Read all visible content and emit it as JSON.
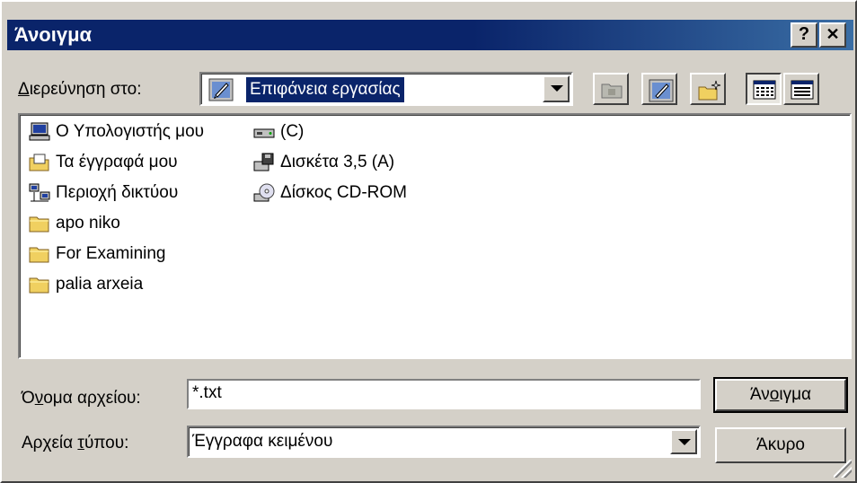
{
  "dialog": {
    "title": "Άνοιγμα",
    "help_btn": "?",
    "close_btn": "✕"
  },
  "lookin": {
    "label_pre": "Δ",
    "label_rest": "ιερεύνηση στο:",
    "value": "Επιφάνεια εργασίας",
    "icon": "desktop-icon"
  },
  "toolbar": {
    "buttons": [
      {
        "name": "up-one-level",
        "icon": "up-folder-icon"
      },
      {
        "name": "desktop",
        "icon": "desktop-icon"
      },
      {
        "name": "new-folder",
        "icon": "new-folder-icon"
      },
      {
        "name": "list-view",
        "icon": "list-view-icon",
        "pressed": true
      },
      {
        "name": "details-view",
        "icon": "details-view-icon"
      }
    ]
  },
  "files": {
    "col1": [
      {
        "label": "Ο Υπολογιστής μου",
        "icon": "my-computer-icon"
      },
      {
        "label": "Τα έγγραφά μου",
        "icon": "my-documents-icon"
      },
      {
        "label": "Περιοχή δικτύου",
        "icon": "network-icon"
      },
      {
        "label": "apo niko",
        "icon": "folder-icon"
      },
      {
        "label": "For Examining",
        "icon": "folder-icon"
      },
      {
        "label": "palia arxeia",
        "icon": "folder-icon"
      }
    ],
    "col2": [
      {
        "label": "(C)",
        "icon": "hard-drive-icon"
      },
      {
        "label": "Δισκέτα 3,5 (A)",
        "icon": "floppy-icon"
      },
      {
        "label": "Δίσκος CD-ROM",
        "icon": "cd-rom-icon"
      }
    ]
  },
  "filename": {
    "label_pre": "Ό",
    "label_ul": "ν",
    "label_rest": "ομα αρχείου:",
    "value": "*.txt"
  },
  "filetype": {
    "label_pre": "Αρχεία ",
    "label_ul": "τ",
    "label_rest": "ύπου:",
    "value": "Έγγραφα κειμένου"
  },
  "buttons": {
    "open": {
      "pre": "Άν",
      "ul": "ο",
      "rest": "ιγμα"
    },
    "cancel": "Άκυρο"
  },
  "colors": {
    "title_bg": "#0a246a",
    "face": "#d4d0c8",
    "selection": "#0a246a"
  }
}
